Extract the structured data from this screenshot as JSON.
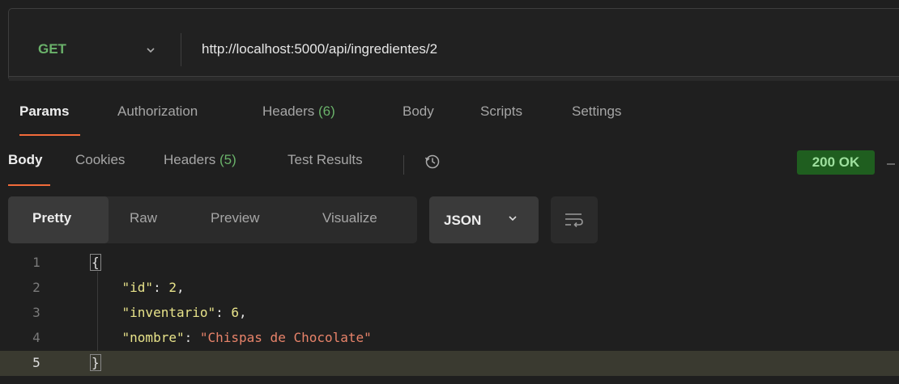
{
  "request": {
    "method": "GET",
    "url": "http://localhost:5000/api/ingredientes/2"
  },
  "request_tabs": [
    {
      "label": "Params",
      "count": ""
    },
    {
      "label": "Authorization",
      "count": ""
    },
    {
      "label": "Headers ",
      "count": "(6)"
    },
    {
      "label": "Body",
      "count": ""
    },
    {
      "label": "Scripts",
      "count": ""
    },
    {
      "label": "Settings",
      "count": ""
    }
  ],
  "response_tabs": [
    {
      "label": "Body",
      "count": ""
    },
    {
      "label": "Cookies",
      "count": ""
    },
    {
      "label": "Headers ",
      "count": "(5)"
    },
    {
      "label": "Test Results",
      "count": ""
    }
  ],
  "status": {
    "text": "200 OK",
    "color": "#1f5e1f"
  },
  "view_modes": [
    "Pretty",
    "Raw",
    "Preview",
    "Visualize"
  ],
  "format": "JSON",
  "code_lines": [
    {
      "num": "1",
      "parts": [
        {
          "t": "{",
          "c": "bracket"
        }
      ]
    },
    {
      "num": "2",
      "parts": [
        {
          "t": "    ",
          "c": "punct"
        },
        {
          "t": "\"id\"",
          "c": "key"
        },
        {
          "t": ": ",
          "c": "punct"
        },
        {
          "t": "2",
          "c": "num"
        },
        {
          "t": ",",
          "c": "punct"
        }
      ]
    },
    {
      "num": "3",
      "parts": [
        {
          "t": "    ",
          "c": "punct"
        },
        {
          "t": "\"inventario\"",
          "c": "key"
        },
        {
          "t": ": ",
          "c": "punct"
        },
        {
          "t": "6",
          "c": "num"
        },
        {
          "t": ",",
          "c": "punct"
        }
      ]
    },
    {
      "num": "4",
      "parts": [
        {
          "t": "    ",
          "c": "punct"
        },
        {
          "t": "\"nombre\"",
          "c": "key"
        },
        {
          "t": ": ",
          "c": "punct"
        },
        {
          "t": "\"Chispas de Chocolate\"",
          "c": "str"
        }
      ]
    },
    {
      "num": "5",
      "parts": [
        {
          "t": "}",
          "c": "bracket"
        }
      ]
    }
  ],
  "icons": {
    "method_dropdown": "chevron-down-icon",
    "history": "history-icon",
    "format_dropdown": "chevron-down-icon",
    "wrap": "wrap-lines-icon"
  },
  "colors": {
    "accent": "#f26b3a",
    "method": "#6ab26a",
    "json_key": "#e8e38a",
    "json_string": "#e8836a"
  }
}
